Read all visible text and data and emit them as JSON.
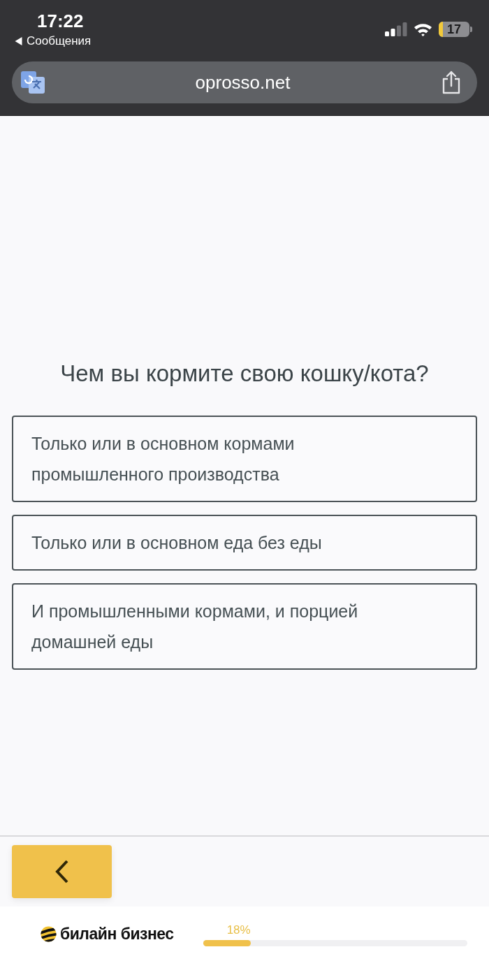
{
  "status_bar": {
    "time": "17:22",
    "back_link": "Сообщения",
    "battery": "17"
  },
  "address_bar": {
    "url": "oprosso.net"
  },
  "question": {
    "title": "Чем вы кормите свою кошку/кота?",
    "options": [
      {
        "label": "Только или в основном кормами промышленного производства",
        "selected": false
      },
      {
        "label": "Только или в основном еда без еды",
        "selected": false
      },
      {
        "label": "И промышленными кормами, и порцией домашней еды",
        "selected": false
      }
    ]
  },
  "footer": {
    "brand": "билайн бизнес",
    "progress": {
      "label": "18%",
      "level": 0.18
    }
  }
}
